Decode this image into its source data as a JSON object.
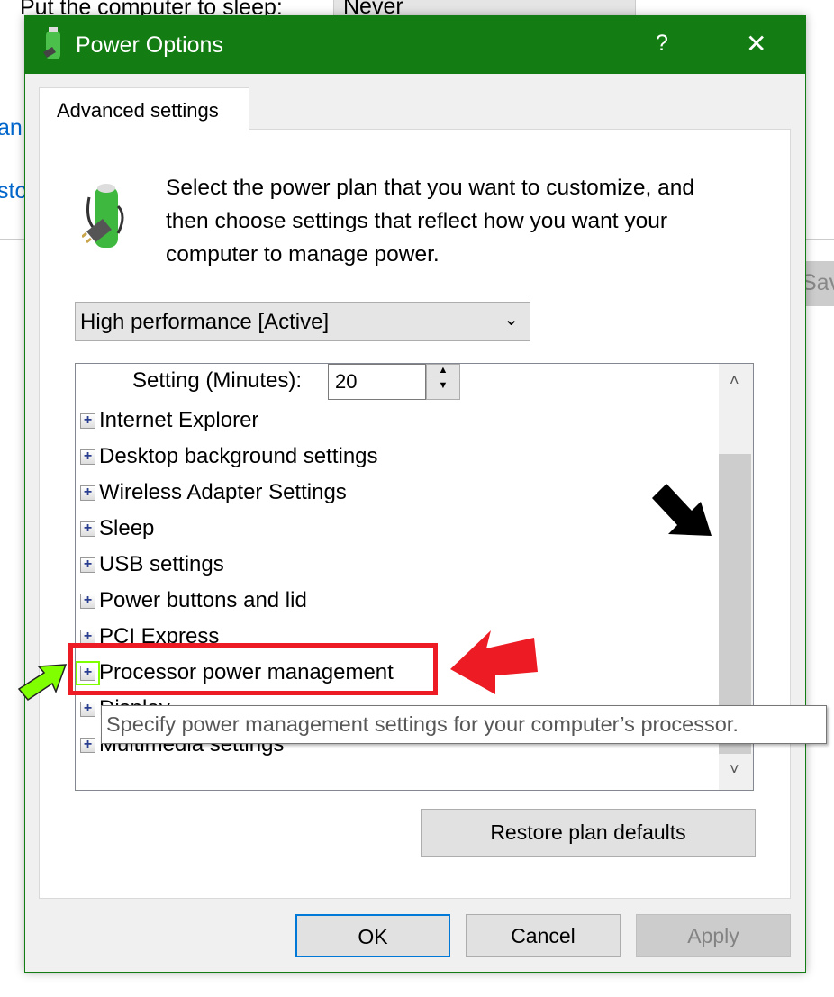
{
  "background": {
    "sleep_label": "Put the computer to sleep:",
    "sleep_value": "Never",
    "link1": "an",
    "link2": "sto",
    "save": "Sav"
  },
  "dialog": {
    "title": "Power Options",
    "help": "?",
    "close": "✕",
    "tab": "Advanced settings",
    "description": [
      "Select the power plan that you want to customize, and",
      "then choose settings that reflect how you want your",
      "computer to manage power."
    ],
    "plan_select": "High performance [Active]",
    "setting_label": "Setting (Minutes):",
    "setting_value": "20",
    "items": [
      {
        "label": "Internet Explorer"
      },
      {
        "label": "Desktop background settings"
      },
      {
        "label": "Wireless Adapter Settings"
      },
      {
        "label": "Sleep"
      },
      {
        "label": "USB settings"
      },
      {
        "label": "Power buttons and lid"
      },
      {
        "label": "PCI Express"
      },
      {
        "label": "Processor power management"
      },
      {
        "label": "Display"
      },
      {
        "label": "Multimedia settings"
      }
    ],
    "tooltip": "Specify power management settings for your computer’s processor.",
    "restore": "Restore plan defaults",
    "ok": "OK",
    "cancel": "Cancel",
    "apply": "Apply"
  },
  "colors": {
    "titlebar": "#137c13",
    "highlight_box": "#ed1c24",
    "arrow_red": "#ed1c24",
    "arrow_green": "#7fff00",
    "arrow_black": "#000000"
  }
}
